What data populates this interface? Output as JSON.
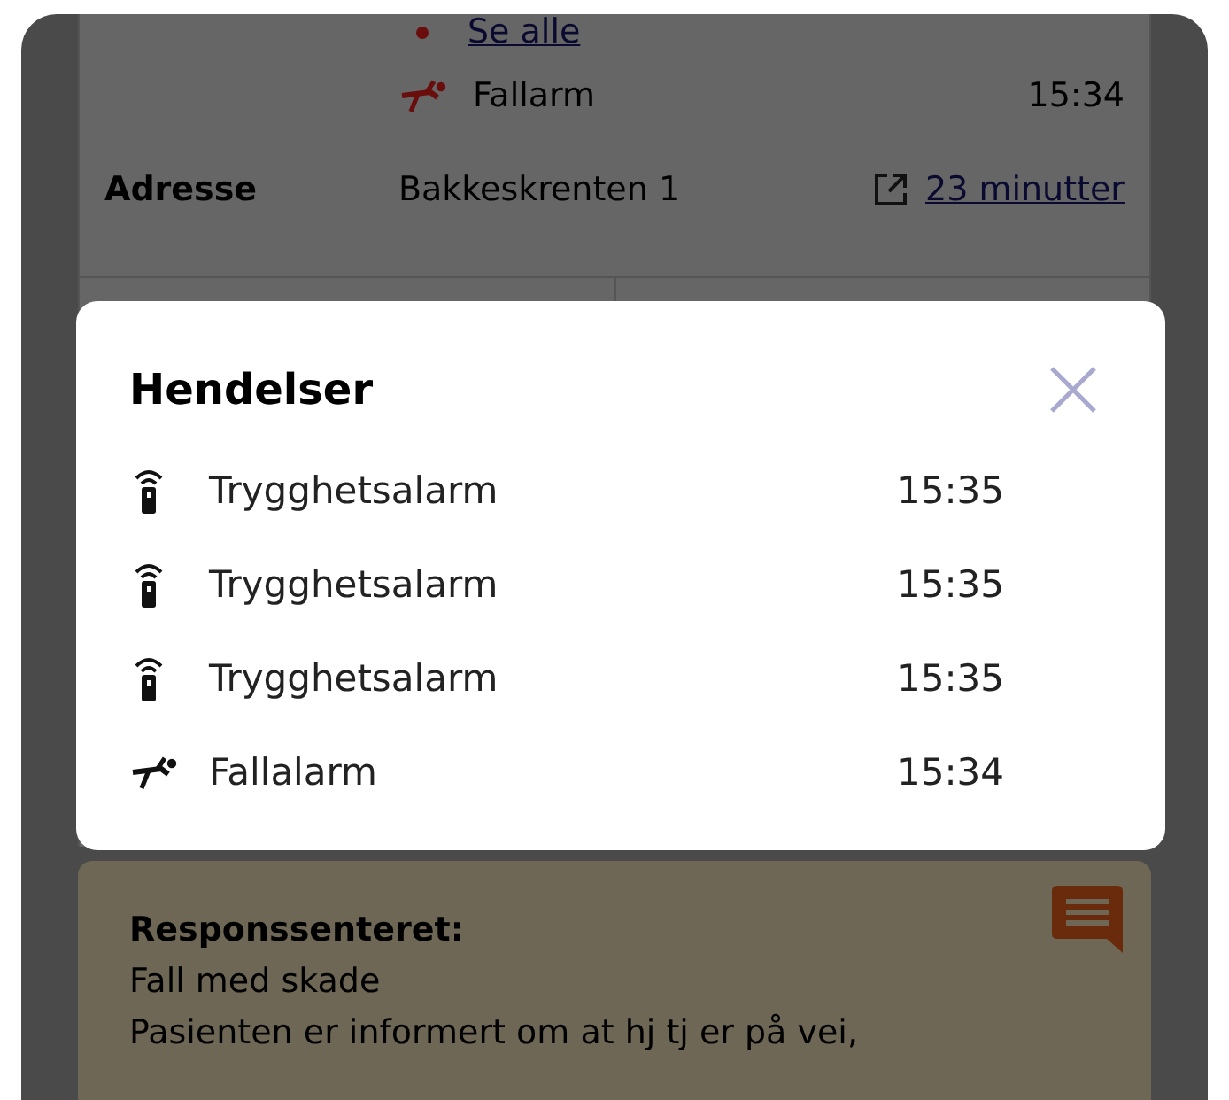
{
  "background": {
    "see_all_link": "Se alle",
    "latest_event": {
      "kind": "fall",
      "label": "Fallarm",
      "time": "15:34"
    },
    "address": {
      "label": "Adresse",
      "value": "Bakkeskrenten 1",
      "link": "23 minutter"
    },
    "response_center": {
      "title": "Responssenteret:",
      "lines": [
        "Fall med skade",
        "Pasienten er informert om at hj tj er på vei,"
      ]
    }
  },
  "dialog": {
    "title": "Hendelser",
    "events": [
      {
        "kind": "alarm",
        "label": "Trygghetsalarm",
        "time": "15:35"
      },
      {
        "kind": "alarm",
        "label": "Trygghetsalarm",
        "time": "15:35"
      },
      {
        "kind": "alarm",
        "label": "Trygghetsalarm",
        "time": "15:35"
      },
      {
        "kind": "fall",
        "label": "Fallalarm",
        "time": "15:34"
      }
    ]
  }
}
